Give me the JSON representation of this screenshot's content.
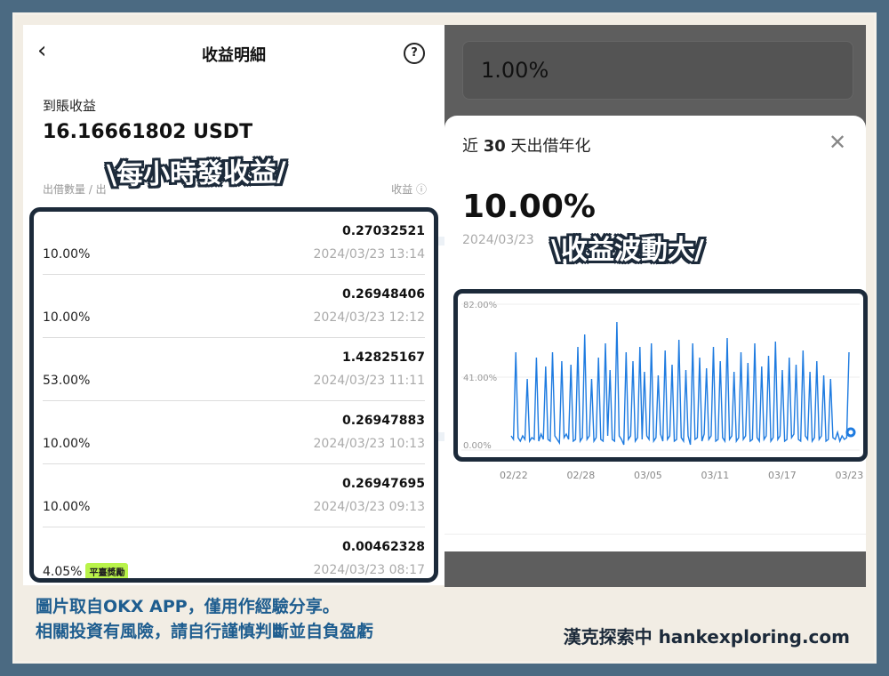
{
  "left_panel": {
    "title": "收益明細",
    "back_icon": "chevron-left-icon",
    "help_icon": "question-circle-icon",
    "earnings_label": "到賬收益",
    "earnings_value": "16.16661802 USDT",
    "col_left": "出借數量 / 出",
    "col_right": "收益 ⓘ",
    "rows": [
      {
        "amount": "0.27032521",
        "rate": "10.00%",
        "time": "2024/03/23 13:14"
      },
      {
        "amount": "0.26948406",
        "rate": "10.00%",
        "time": "2024/03/23 12:12"
      },
      {
        "amount": "1.42825167",
        "rate": "53.00%",
        "time": "2024/03/23 11:11"
      },
      {
        "amount": "0.26947883",
        "rate": "10.00%",
        "time": "2024/03/23 10:13"
      },
      {
        "amount": "0.26947695",
        "rate": "10.00%",
        "time": "2024/03/23 09:13"
      },
      {
        "amount": "0.00462328",
        "rate": "4.05%",
        "badge": "平臺獎勵",
        "time": "2024/03/23 08:17"
      }
    ]
  },
  "overlay": {
    "left_caption": "\\每小時發收益/",
    "right_caption": "\\收益波動大/"
  },
  "right_panel": {
    "input_value": "1.00%",
    "sheet_title_prefix": "近 ",
    "sheet_title_bold": "30",
    "sheet_title_suffix": " 天出借年化",
    "close_icon": "close-icon",
    "big_rate": "10.00%",
    "date": "2024/03/23"
  },
  "chart_data": {
    "type": "line",
    "ytick_labels": [
      "82.00%",
      "41.00%",
      "0.00%"
    ],
    "ylim": [
      0,
      82
    ],
    "xtick_labels": [
      "02/22",
      "02/28",
      "03/05",
      "03/11",
      "03/17",
      "03/23"
    ],
    "series_color": "#1e7be0",
    "values": [
      8,
      6,
      55,
      7,
      5,
      8,
      6,
      40,
      5,
      7,
      6,
      52,
      5,
      9,
      6,
      47,
      6,
      5,
      55,
      8,
      6,
      4,
      50,
      7,
      9,
      6,
      48,
      5,
      6,
      58,
      5,
      7,
      65,
      6,
      8,
      40,
      5,
      7,
      52,
      6,
      5,
      60,
      8,
      45,
      6,
      5,
      72,
      8,
      6,
      3,
      55,
      6,
      8,
      50,
      5,
      7,
      58,
      6,
      44,
      8,
      6,
      60,
      5,
      7,
      42,
      9,
      5,
      56,
      6,
      8,
      48,
      5,
      6,
      62,
      7,
      5,
      45,
      8,
      3,
      60,
      6,
      7,
      52,
      5,
      9,
      46,
      6,
      8,
      58,
      5,
      6,
      50,
      7,
      5,
      63,
      6,
      8,
      44,
      5,
      7,
      55,
      6,
      8,
      49,
      5,
      6,
      60,
      7,
      5,
      47,
      6,
      8,
      53,
      5,
      7,
      61,
      6,
      8,
      45,
      5,
      6,
      52,
      7,
      9,
      48,
      6,
      5,
      56,
      8,
      6,
      44,
      5,
      7,
      50,
      6,
      8,
      42,
      5,
      6,
      40,
      7,
      6,
      10,
      5,
      8,
      6,
      7,
      55
    ],
    "last_value": 10
  },
  "footer": {
    "line1": "圖片取自OKX  APP，僅用作經驗分享。",
    "line2": "相關投資有風險，請自行謹慎判斷並自負盈虧",
    "brand": "漢克探索中 hankexploring.com"
  }
}
